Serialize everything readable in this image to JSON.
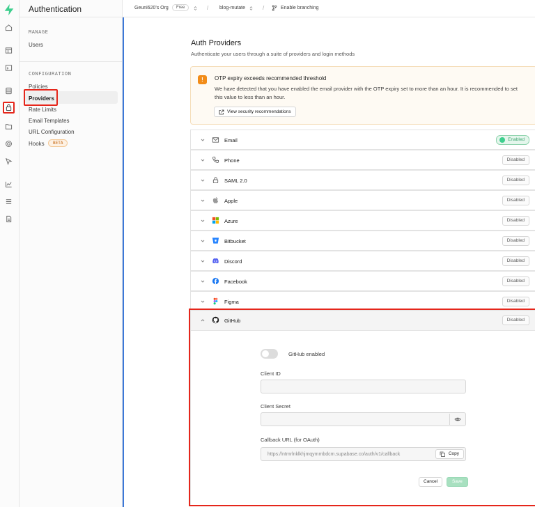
{
  "app": {
    "section_title": "Authentication",
    "accent": "#3ecf8e"
  },
  "rail": {
    "items": [
      {
        "name": "home-icon"
      },
      {
        "name": "table-editor-icon"
      },
      {
        "name": "sql-editor-icon"
      },
      {
        "name": "database-icon"
      },
      {
        "name": "auth-lock-icon",
        "active": true
      },
      {
        "name": "storage-icon"
      },
      {
        "name": "realtime-icon"
      },
      {
        "name": "edge-functions-icon"
      },
      {
        "name": "reports-icon"
      },
      {
        "name": "logs-icon"
      },
      {
        "name": "docs-icon"
      }
    ]
  },
  "sidebar": {
    "manage_heading": "MANAGE",
    "manage_items": [
      "Users"
    ],
    "config_heading": "CONFIGURATION",
    "config_items": [
      "Policies",
      "Providers",
      "Rate Limits",
      "Email Templates",
      "URL Configuration",
      "Hooks"
    ],
    "selected": "Providers",
    "hooks_badge": "BETA"
  },
  "topbar": {
    "org": "Geuni620's Org",
    "plan": "Free",
    "project": "blog-mutate",
    "branching": "Enable branching"
  },
  "page": {
    "title": "Auth Providers",
    "subtitle": "Authenticate your users through a suite of providers and login methods"
  },
  "warning": {
    "title": "OTP expiry exceeds recommended threshold",
    "body": "We have detected that you have enabled the email provider with the OTP expiry set to more than an hour. It is recommended to set this value to less than an hour.",
    "button": "View security recommendations",
    "color": "#f28c18"
  },
  "providers": [
    {
      "name": "Email",
      "status": "Enabled",
      "icon": "mail-icon"
    },
    {
      "name": "Phone",
      "status": "Disabled",
      "icon": "phone-icon"
    },
    {
      "name": "SAML 2.0",
      "status": "Disabled",
      "icon": "lock-icon"
    },
    {
      "name": "Apple",
      "status": "Disabled",
      "icon": "apple-icon"
    },
    {
      "name": "Azure",
      "status": "Disabled",
      "icon": "azure-icon"
    },
    {
      "name": "Bitbucket",
      "status": "Disabled",
      "icon": "bitbucket-icon"
    },
    {
      "name": "Discord",
      "status": "Disabled",
      "icon": "discord-icon"
    },
    {
      "name": "Facebook",
      "status": "Disabled",
      "icon": "facebook-icon"
    },
    {
      "name": "Figma",
      "status": "Disabled",
      "icon": "figma-icon"
    }
  ],
  "github": {
    "name": "GitHub",
    "status": "Disabled",
    "toggle_label": "GitHub enabled",
    "enabled": false,
    "client_id_label": "Client ID",
    "client_id_value": "",
    "client_secret_label": "Client Secret",
    "client_secret_value": "",
    "callback_label": "Callback URL (for OAuth)",
    "callback_value": "https://ntmrlnklkhjmqymmbdcm.supabase.co/auth/v1/callback",
    "copy_label": "Copy",
    "cancel_label": "Cancel",
    "save_label": "Save"
  }
}
